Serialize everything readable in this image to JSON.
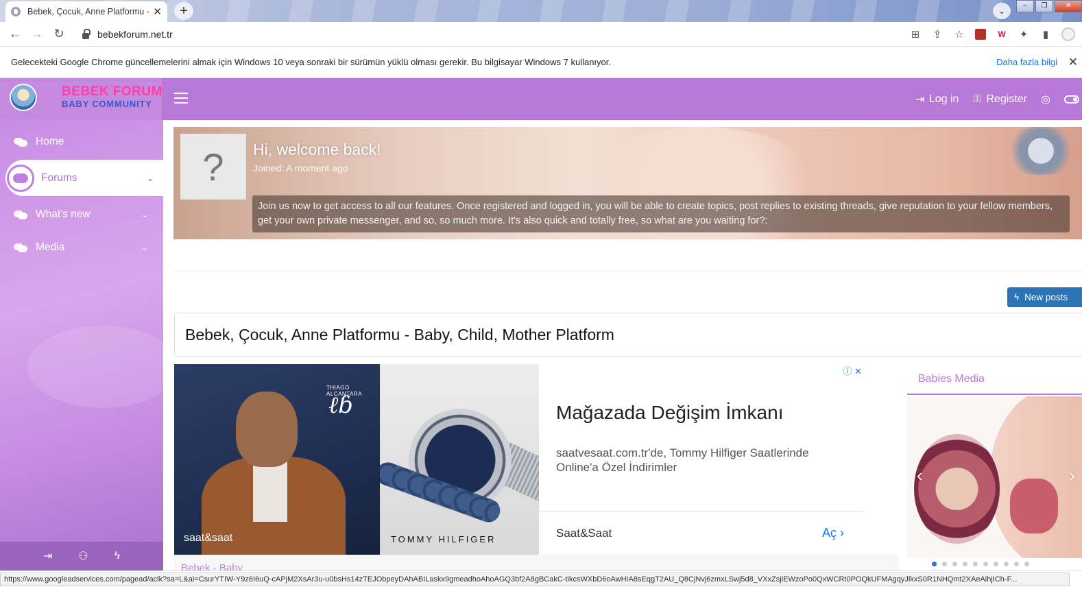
{
  "browser": {
    "tab_title": "Bebek, Çocuk, Anne Platformu - B",
    "url": "bebekforum.net.tr",
    "new_tab_symbol": "+",
    "tab_close_symbol": "✕"
  },
  "infobar": {
    "message": "Gelecekteki Google Chrome güncellemelerini almak için Windows 10 veya sonraki bir sürümün yüklü olması gerekir. Bu bilgisayar Windows 7 kullanıyor.",
    "link": "Daha fazla bilgi",
    "close": "✕"
  },
  "site": {
    "logo_line1": "BEBEK FORUM",
    "logo_line2": "BABY COMMUNITY",
    "login_label": "Log in",
    "register_label": "Register"
  },
  "sidebar": {
    "items": [
      {
        "label": "Home"
      },
      {
        "label": "Forums"
      },
      {
        "label": "What's new"
      },
      {
        "label": "Media"
      }
    ]
  },
  "welcome": {
    "avatar_placeholder": "?",
    "title": "Hi, welcome back!",
    "joined": "Joined: A moment ago",
    "message": "Join us now to get access to all our features. Once registered and logged in, you will be able to create topics, post replies to existing threads, give reputation to your fellow members, get your own private messenger, and so, so much more. It's also quick and totally free, so what are you waiting for?:"
  },
  "main": {
    "new_posts_label": "New posts",
    "page_title": "Bebek, Çocuk, Anne Platformu - Baby, Child, Mother Platform",
    "section_peek": "Bebek - Baby"
  },
  "ad": {
    "person_caption": "THIAGO ALCANTARA",
    "brand_left": "saat&saat",
    "brand_right": "TOMMY  HILFIGER",
    "headline": "Mağazada Değişim İmkanı",
    "description": "saatvesaat.com.tr'de, Tommy Hilfiger Saatlerinde Online'a Özel İndirimler",
    "advertiser": "Saat&Saat",
    "cta": "Aç",
    "close": "ⓘ ✕"
  },
  "media_block": {
    "title": "Babies Media",
    "slide_count": 10,
    "active_slide": 1
  },
  "statusbar": {
    "url": "https://www.googleadservices.com/pagead/aclk?sa=L&ai=CsurYTIW-Y9z6I6uQ-cAPjM2XsAr3u-u0bsHs14zTEJObpeyDAhABILaskx9gmeadhoAhoAGQ3bf2A8gBCakC-tikcsWXbD6oAwHIA8sEqgT2AU_Q8CjNvj6zmxLSwj5d8_VXxZsjiEWzoPo0QxWCRt0POQkUFMAgqyJlkxS0R1NHQmt2XAeAihjICh-F..."
  }
}
